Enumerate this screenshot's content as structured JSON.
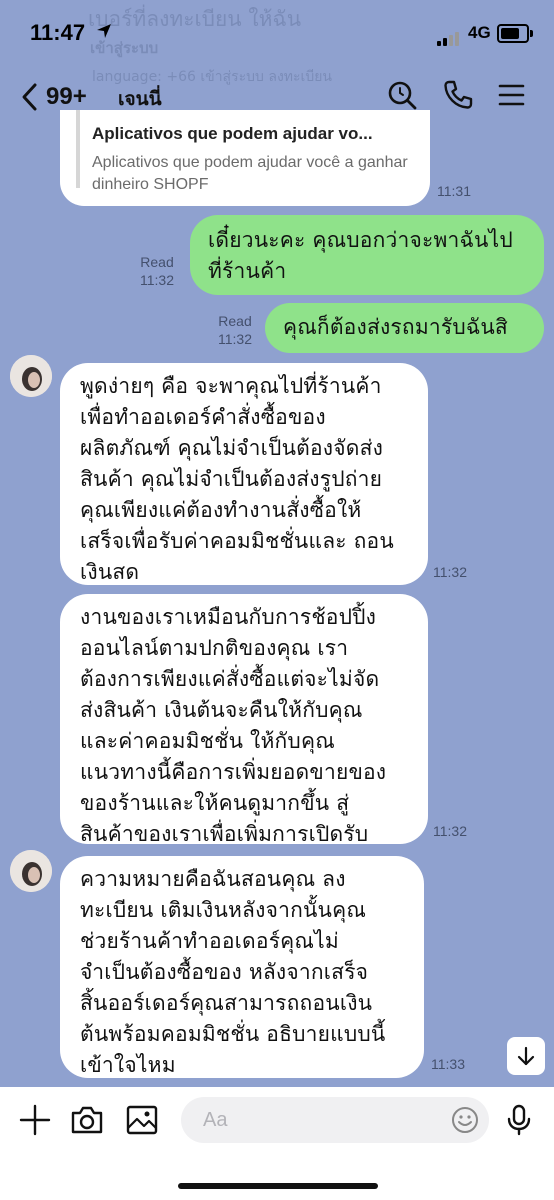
{
  "status_bar": {
    "time": "11:47",
    "network": "4G"
  },
  "header_preview": {
    "line1": "เบอร์ที่ลงทะเบียน ให้ฉัน",
    "line2": "เข้าสู่ระบบ",
    "line3": "language: +66 เข้าสู่ระบบ ลงทะเบียน"
  },
  "nav": {
    "back_count": "99+",
    "chat_name": "เจนนี่"
  },
  "link_card": {
    "title": "Aplicativos que podem ajudar vo...",
    "description": "Aplicativos que podem ajudar você a ganhar dinheiro SHOPF",
    "time": "11:31"
  },
  "messages": [
    {
      "direction": "out",
      "text": "เดี๋ยวนะคะ คุณบอกว่าจะพาฉันไป\nที่ร้านค้า",
      "read_label": "Read",
      "time": "11:32"
    },
    {
      "direction": "out",
      "text": "คุณก็ต้องส่งรถมารับฉันสิ",
      "read_label": "Read",
      "time": "11:32"
    },
    {
      "direction": "in",
      "text": "พูดง่ายๆ คือ จะพาคุณไปที่ร้านค้า\nเพื่อทำออเดอร์คำสั่งซื้อของ\nผลิตภัณฑ์ คุณไม่จำเป็นต้องจัดส่ง\nสินค้า คุณไม่จำเป็นต้องส่งรูปถ่าย\nคุณเพียงแค่ต้องทำงานสั่งซื้อให้\nเสร็จเพื่อรับค่าคอมมิชชั่นและ ถอน\nเงินสด",
      "time": "11:32"
    },
    {
      "direction": "in",
      "text": "งานของเราเหมือนกับการช้อปปิ้ง\nออนไลน์ตามปกติของคุณ เรา\nต้องการเพียงแค่สั่งซื้อแต่จะไม่จัด\nส่งสินค้า เงินต้นจะคืนให้กับคุณ\nและค่าคอมมิชชั่น ให้กับคุณ\nแนวทางนี้คือการเพิ่มยอดขายของ\nของร้านและให้คนดูมากขึ้น สู่\nสินค้าของเราเพื่อเพิ่มการเปิดรับ",
      "time": "11:32"
    },
    {
      "direction": "in",
      "text": "ความหมายคือฉันสอนคุณ ลง\nทะเบียน เติมเงินหลังจากนั้นคุณ\nช่วยร้านค้าทำออเดอร์คุณไม่\nจำเป็นต้องซื้อของ หลังจากเสร็จ\nสิ้นออร์เดอร์คุณสามารถถอนเงิน\nต้นพร้อมคอมมิชชั่น อธิบายแบบนี้\nเข้าใจไหม",
      "time": "11:33"
    }
  ],
  "input": {
    "placeholder": "Aa"
  },
  "colors": {
    "background": "#8fa1cf",
    "outgoing_bubble": "#8fe28a",
    "incoming_bubble": "#ffffff"
  }
}
